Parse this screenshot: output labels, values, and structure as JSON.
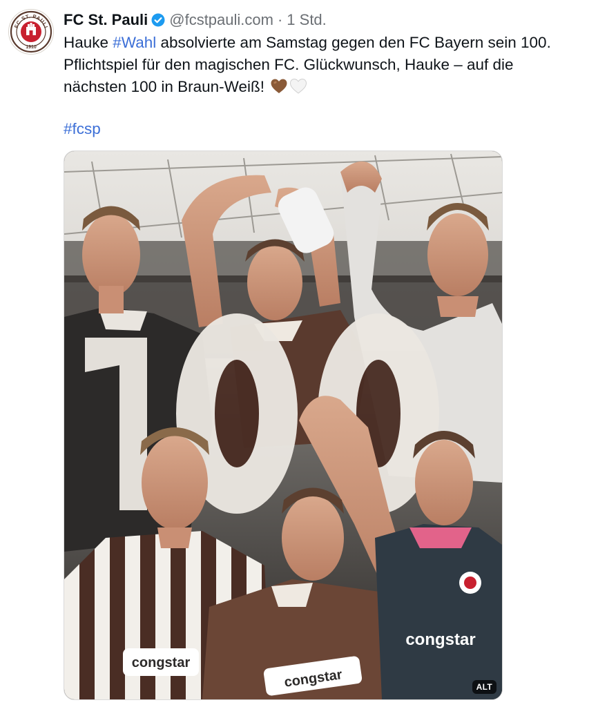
{
  "post": {
    "display_name": "FC St. Pauli",
    "handle": "@fcstpauli.com",
    "separator": "·",
    "time": "1 Std.",
    "text_before_tag": "Hauke ",
    "inline_hashtag": "#Wahl",
    "text_after_tag_line1": " absolvierte am Samstag gegen den FC Bayern sein 100.",
    "text_line2": "Pflichtspiel für den magischen FC. Glückwunsch, Hauke – auf die",
    "text_line3": "nächsten 100 in Braun-Weiß!",
    "emojis": [
      "brown-heart-icon",
      "white-heart-icon"
    ],
    "hashtag": "#fcsp"
  },
  "logo": {
    "top_text": "FC ST. PAULI",
    "year": "1910"
  },
  "media": {
    "big_number": "100",
    "sponsor": "congstar",
    "alt_badge": "ALT"
  },
  "colors": {
    "text": "#0f1419",
    "muted": "#6b6f74",
    "link": "#3c6fd7",
    "verified": "#1d9bf0",
    "club_brown": "#5a3a2e",
    "club_red": "#c8202f"
  }
}
